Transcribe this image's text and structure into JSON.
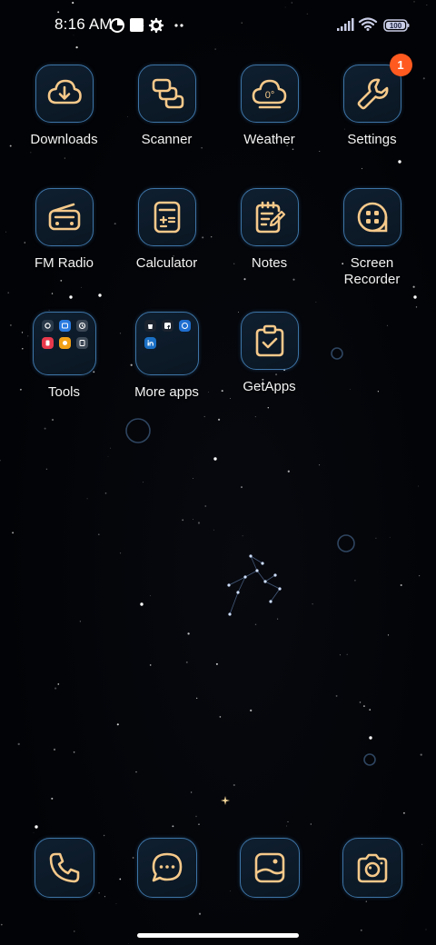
{
  "status_bar": {
    "time": "8:16 AM",
    "left_icons": [
      "data-saver-icon",
      "gallery-notification-icon",
      "settings-gear-icon",
      "more-dots-icon"
    ],
    "right_icons": [
      "signal-icon",
      "wifi-icon",
      "battery-icon"
    ],
    "battery_level": "100"
  },
  "apps": [
    {
      "label": "Downloads",
      "icon": "download-cloud-icon"
    },
    {
      "label": "Scanner",
      "icon": "scanner-icon"
    },
    {
      "label": "Weather",
      "icon": "weather-cloud-icon",
      "temperature": "0°"
    },
    {
      "label": "Settings",
      "icon": "wrench-icon",
      "badge": "1"
    },
    {
      "label": "FM Radio",
      "icon": "radio-icon"
    },
    {
      "label": "Calculator",
      "icon": "calculator-icon"
    },
    {
      "label": "Notes",
      "icon": "notepad-icon"
    },
    {
      "label": "Screen\nRecorder",
      "icon": "film-reel-icon"
    },
    {
      "label": "Tools",
      "icon": "folder-icon"
    },
    {
      "label": "More apps",
      "icon": "folder-icon"
    },
    {
      "label": "GetApps",
      "icon": "clipboard-check-icon"
    }
  ],
  "dock": [
    {
      "name": "Phone",
      "icon": "phone-icon"
    },
    {
      "name": "Messaging",
      "icon": "message-bubble-icon"
    },
    {
      "name": "Gallery",
      "icon": "gallery-icon"
    },
    {
      "name": "Camera",
      "icon": "camera-icon"
    }
  ],
  "colors": {
    "icon_glyph": "#f6c98a",
    "icon_border": "#3d74a6",
    "badge": "#ff5a1f",
    "background": "#020306"
  }
}
